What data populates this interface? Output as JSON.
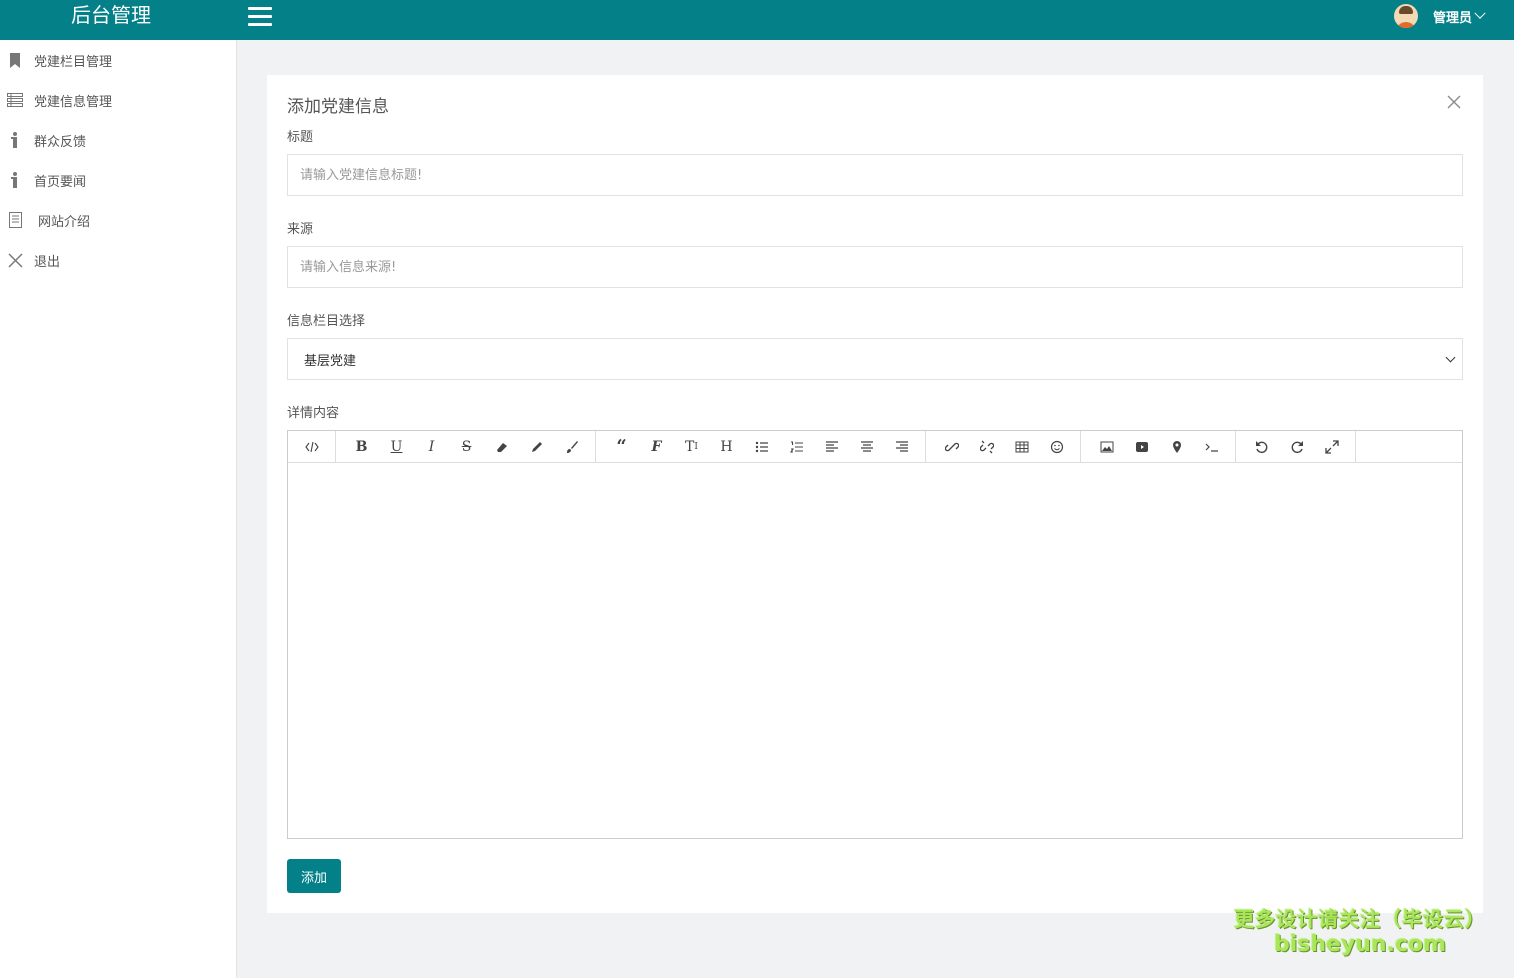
{
  "header": {
    "brand": "后台管理",
    "user_name": "管理员"
  },
  "sidebar": {
    "items": [
      {
        "label": "党建栏目管理",
        "icon": "bookmark-icon"
      },
      {
        "label": "党建信息管理",
        "icon": "list-icon"
      },
      {
        "label": "群众反馈",
        "icon": "info-icon"
      },
      {
        "label": "首页要闻",
        "icon": "info-icon"
      },
      {
        "label": "网站介绍",
        "icon": "document-icon"
      },
      {
        "label": "退出",
        "icon": "close-icon"
      }
    ]
  },
  "form": {
    "title": "添加党建信息",
    "title_label": "标题",
    "title_placeholder": "请输入党建信息标题!",
    "source_label": "来源",
    "source_placeholder": "请输入信息来源!",
    "category_label": "信息栏目选择",
    "category_value": "基层党建",
    "content_label": "详情内容",
    "submit_label": "添加"
  },
  "editor": {
    "toolbar_groups": [
      [
        "code-view"
      ],
      [
        "bold",
        "underline",
        "italic",
        "strikethrough",
        "eraser",
        "pencil",
        "brush"
      ],
      [
        "quote",
        "font",
        "font-size",
        "heading",
        "unordered-list",
        "ordered-list",
        "align-left",
        "align-center",
        "align-right"
      ],
      [
        "link",
        "unlink",
        "table",
        "emoticon"
      ],
      [
        "image",
        "video",
        "location",
        "terminal"
      ],
      [
        "undo",
        "redo",
        "fullscreen"
      ]
    ]
  },
  "watermark": {
    "line1": "更多设计请关注（毕设云）",
    "line2": "bisheyun.com"
  },
  "colors": {
    "primary": "#038088",
    "background": "#f1f2f4",
    "watermark": "#a9e65a"
  }
}
